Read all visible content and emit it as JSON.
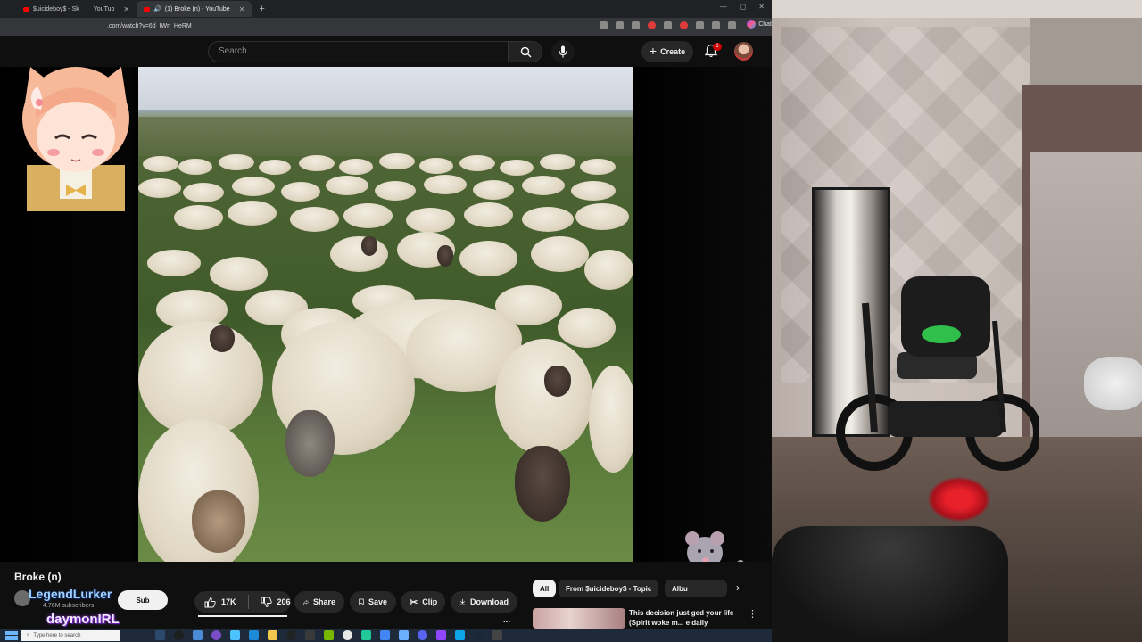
{
  "browser": {
    "tabs": [
      {
        "label": "$uicideboy$ - Sk",
        "active": false
      },
      {
        "label": "YouTub",
        "active": false
      },
      {
        "label": "(1) Broke (n) - YouTube",
        "active": true
      }
    ],
    "url": ".com/watch?v=6d_IWn_HeRM",
    "chat_label": "Chat"
  },
  "youtube": {
    "search_placeholder": "Search",
    "create_label": "Create",
    "notification_count": "1",
    "video_title": "Broke (n)",
    "channel": {
      "subscribers": "4.76M subscribers",
      "subscribe_label": "Sub"
    },
    "actions": {
      "likes": "17K",
      "dislikes": "206",
      "share": "Share",
      "save": "Save",
      "clip": "Clip",
      "download": "Download",
      "more": "..."
    },
    "chips": [
      "All",
      "From $uicideboy$ - Topic",
      "Albu"
    ],
    "recommendation": {
      "title": "This decision just ged your life (Spirit woke m... e daily"
    }
  },
  "overlays": {
    "legend": "LegendLurker",
    "daymon": "daymonIRL"
  },
  "taskbar": {
    "search_placeholder": "Type here to search"
  },
  "colors": {
    "youtube_bg": "#0f0f0f",
    "yt_red": "#ff0000",
    "pill_bg": "#272727"
  }
}
